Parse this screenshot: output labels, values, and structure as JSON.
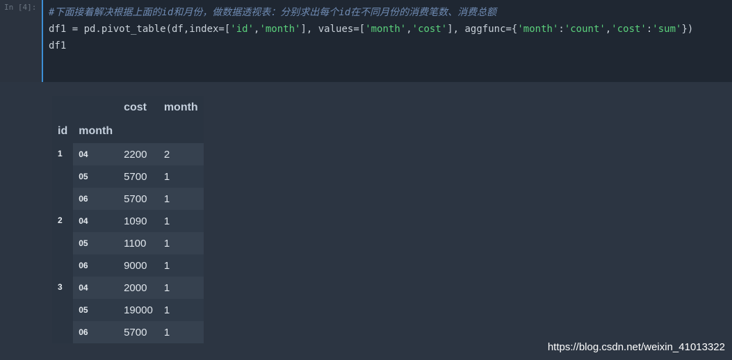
{
  "cell": {
    "prompt": "In [4]:",
    "code_lines": [
      "#下面接着解决根据上面的id和月份，做数据透视表：分别求出每个id在不同月份的消费笔数、消费总额",
      "df1 = pd.pivot_table(df,index=['id','month'], values=['month','cost'], aggfunc={'month':'count','cost':'sum'})",
      "df1"
    ]
  },
  "output": {
    "columns": [
      "cost",
      "month"
    ],
    "index_names": [
      "id",
      "month"
    ],
    "groups": [
      {
        "id": "1",
        "rows": [
          {
            "month": "04",
            "cost": "2200",
            "count": "2"
          },
          {
            "month": "05",
            "cost": "5700",
            "count": "1"
          },
          {
            "month": "06",
            "cost": "5700",
            "count": "1"
          }
        ]
      },
      {
        "id": "2",
        "rows": [
          {
            "month": "04",
            "cost": "1090",
            "count": "1"
          },
          {
            "month": "05",
            "cost": "1100",
            "count": "1"
          },
          {
            "month": "06",
            "cost": "9000",
            "count": "1"
          }
        ]
      },
      {
        "id": "3",
        "rows": [
          {
            "month": "04",
            "cost": "2000",
            "count": "1"
          },
          {
            "month": "05",
            "cost": "19000",
            "count": "1"
          },
          {
            "month": "06",
            "cost": "5700",
            "count": "1"
          }
        ]
      }
    ]
  },
  "watermark": "https://blog.csdn.net/weixin_41013322"
}
